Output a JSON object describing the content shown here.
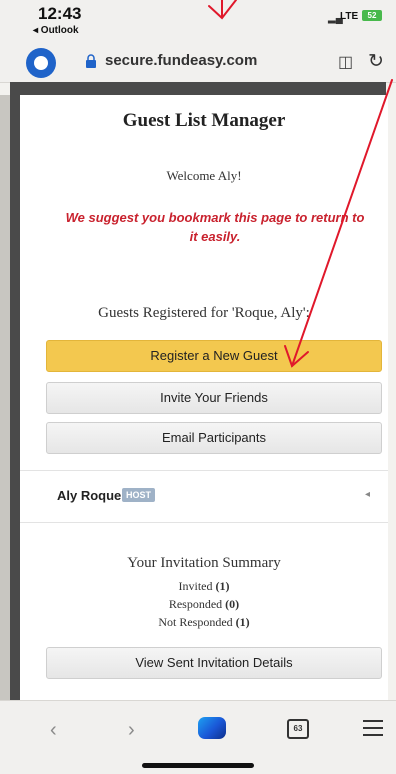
{
  "status_bar": {
    "time": "12:43",
    "back_app": "◂ Outlook",
    "network": "LTE",
    "battery": "52"
  },
  "browser": {
    "url": "secure.fundeasy.com"
  },
  "page": {
    "title": "Guest List Manager",
    "welcome": "Welcome Aly!",
    "suggest": "We suggest you bookmark this page to return to it easily.",
    "guests_registered": "Guests Registered for 'Roque, Aly':",
    "buttons": {
      "register": "Register a New Guest",
      "invite": "Invite Your Friends",
      "email": "Email Participants",
      "view_sent": "View Sent Invitation Details"
    },
    "host": {
      "name": "Aly Roque",
      "badge": "HOST"
    },
    "summary": {
      "title": "Your Invitation Summary",
      "invited_label": "Invited",
      "invited_value": "(1)",
      "responded_label": "Responded",
      "responded_value": "(0)",
      "not_responded_label": "Not Responded",
      "not_responded_value": "(1)"
    }
  },
  "toolbar": {
    "tab_count": "63"
  },
  "colors": {
    "primary_button": "#f3c84f",
    "warning_text": "#c9222e",
    "annotation": "#e0182b"
  }
}
